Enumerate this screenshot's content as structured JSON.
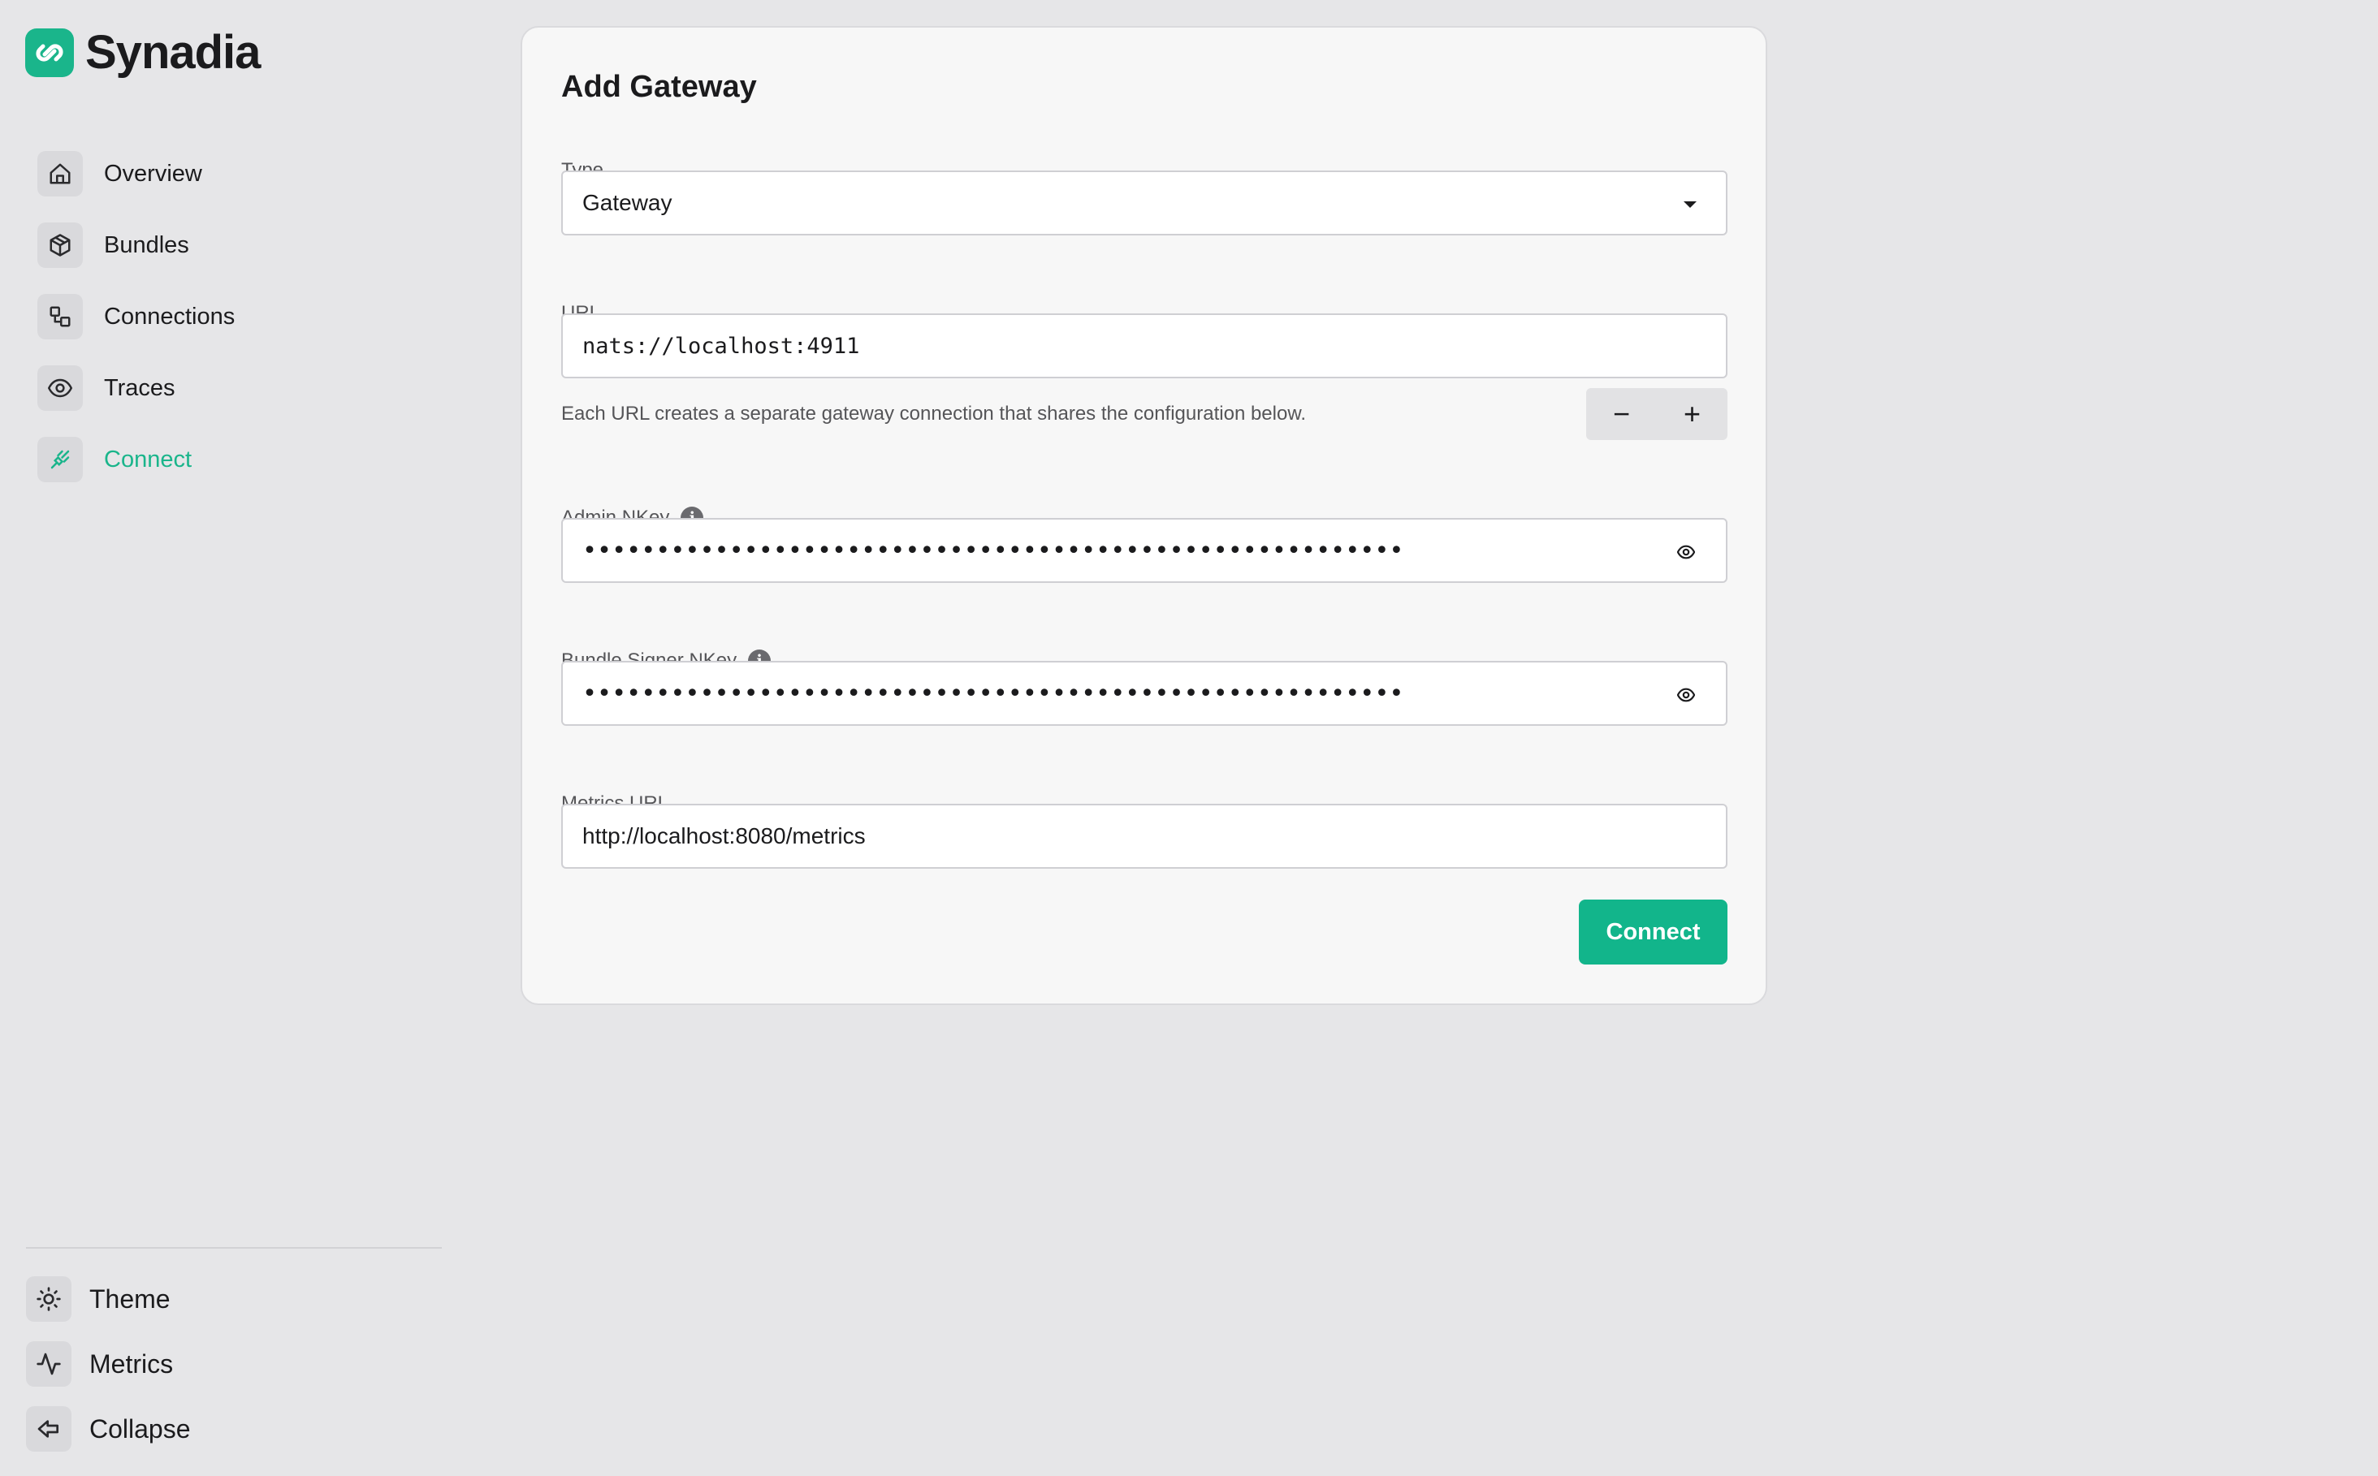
{
  "brand": {
    "name": "Synadia"
  },
  "sidebar": {
    "items": [
      {
        "label": "Overview",
        "icon": "home-icon"
      },
      {
        "label": "Bundles",
        "icon": "package-icon"
      },
      {
        "label": "Connections",
        "icon": "connections-icon"
      },
      {
        "label": "Traces",
        "icon": "eye-icon"
      },
      {
        "label": "Connect",
        "icon": "plug-icon",
        "active": true
      }
    ],
    "bottom_items": [
      {
        "label": "Theme",
        "icon": "sun-icon"
      },
      {
        "label": "Metrics",
        "icon": "activity-icon"
      },
      {
        "label": "Collapse",
        "icon": "collapse-icon"
      }
    ]
  },
  "form": {
    "title": "Add Gateway",
    "type_label": "Type",
    "type_value": "Gateway",
    "url_label": "URL",
    "url_value": "nats://localhost:4911",
    "url_helper": "Each URL creates a separate gateway connection that shares the configuration below.",
    "stepper_minus": "−",
    "stepper_plus": "+",
    "admin_nkey_label": "Admin NKey",
    "admin_nkey_value": "••••••••••••••••••••••••••••••••••••••••••••••••••••••••",
    "bundle_signer_label": "Bundle Signer NKey",
    "bundle_signer_value": "••••••••••••••••••••••••••••••••••••••••••••••••••••••••",
    "metrics_url_label": "Metrics URL",
    "metrics_url_value": "http://localhost:8080/metrics",
    "submit_label": "Connect"
  },
  "colors": {
    "accent": "#12b58b",
    "background": "#e6e6e8",
    "card": "#f7f7f7"
  }
}
